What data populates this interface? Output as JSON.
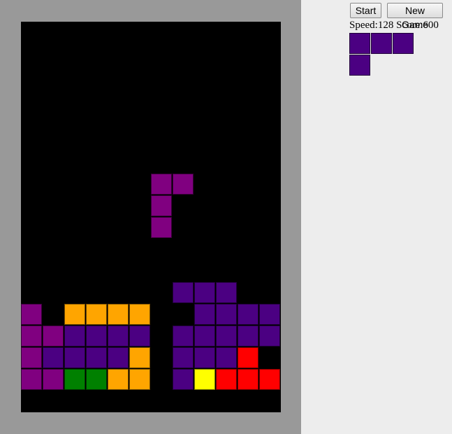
{
  "board": {
    "cols": 12,
    "rows": 18,
    "background": "#000000",
    "colors": {
      "P": "#800080",
      "I": "#4b0082",
      "O": "#ffa500",
      "G": "#008000",
      "Y": "#ffff00",
      "R": "#ff0000"
    },
    "settled": [
      "............",
      "............",
      "............",
      "............",
      "............",
      "............",
      "............",
      "............",
      "............",
      "............",
      "............",
      "............",
      ".......III..",
      "P.OOOO..IIII",
      "PPIIII.IIIII",
      "PIIIIO.IIIR.",
      "PPGGOO.IYRRR",
      "............"
    ],
    "active_piece": {
      "color": "#800080",
      "cells": [
        [
          6,
          7
        ],
        [
          7,
          7
        ],
        [
          6,
          8
        ],
        [
          6,
          9
        ]
      ]
    }
  },
  "controls": {
    "start_label": "Start",
    "new_game_label": "New Game"
  },
  "stats": {
    "text": "Speed:128 Score:600"
  },
  "next_piece": {
    "color": "#4b0082",
    "cells": [
      [
        0,
        0
      ],
      [
        1,
        0
      ],
      [
        2,
        0
      ],
      [
        0,
        1
      ]
    ]
  }
}
